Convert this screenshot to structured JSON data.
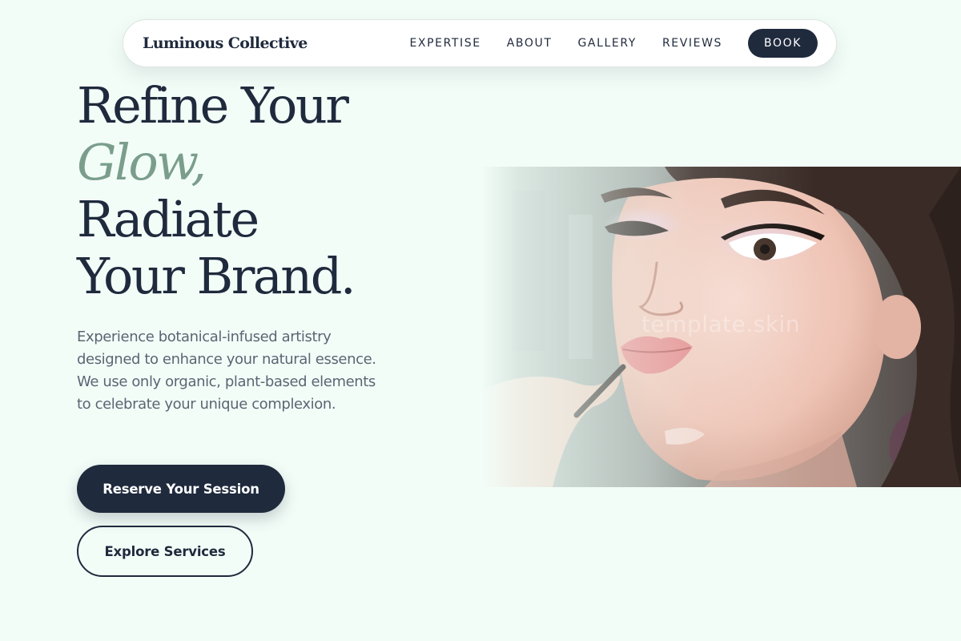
{
  "brand": {
    "name": "Luminous Collective"
  },
  "nav": {
    "links": [
      {
        "label": "EXPERTISE"
      },
      {
        "label": "ABOUT"
      },
      {
        "label": "GALLERY"
      },
      {
        "label": "REVIEWS"
      }
    ],
    "cta_label": "BOOK"
  },
  "hero": {
    "title_line_1": "Refine Your",
    "title_accent": "Glow,",
    "title_line_3": "Radiate",
    "title_line_4": "Your Brand.",
    "description": "Experience botanical-infused artistry designed to enhance your natural essence. We use only organic, plant-based elements to celebrate your unique complexion.",
    "primary_button": "Reserve Your Session",
    "secondary_button": "Explore Services"
  },
  "image": {
    "subject": "makeup-artist-applying-lipstick-photo",
    "watermark": "template.skin"
  },
  "colors": {
    "background": "#f3fdf8",
    "navy": "#1f2a3d",
    "accent_sage": "#7b9e8c",
    "body_text": "#5b6573"
  }
}
